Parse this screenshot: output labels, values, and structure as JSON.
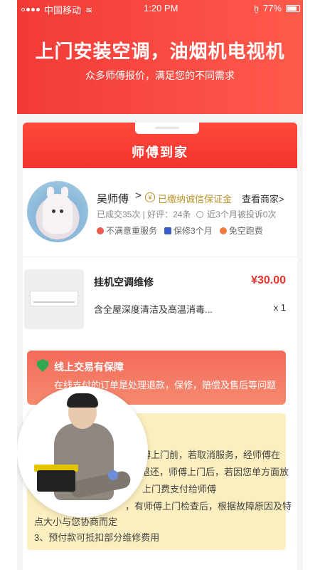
{
  "status_bar": {
    "carrier": "中国移动",
    "time": "1:20 PM",
    "battery": "77%"
  },
  "header": {
    "title": "上门安装空调，油烟机电视机",
    "subtitle": "众多师傅报价，满足您的不同需求"
  },
  "band": {
    "title": "师傅到家"
  },
  "master": {
    "name": "吴师傅",
    "arrow": ">",
    "deposit": "已缴纳诚信保证金",
    "view_shop": "查看商家>",
    "stats_a": "已成交35次 | 好评：24条",
    "stats_b": "近3个月被投诉0次",
    "tags": [
      "不满意重服务",
      "保修3个月",
      "免空跑费"
    ]
  },
  "service": {
    "title": "挂机空调维修",
    "price": "¥30.00",
    "desc": "含全屋深度清洁及高温消毒...",
    "qty": "x 1"
  },
  "guarantee": {
    "title": "线上交易有保障",
    "text": "在线支付的订单是处理退款，保修，赔偿及售后等问题"
  },
  "notice": {
    "line1": "师傅上门前，若取消服务，经师傅在",
    "line2": "退还，师傅上门后，若因您单方面放",
    "line3": "上门费支付给师傅",
    "line4": "，有师傅上门检查后，根据故障原因及特",
    "line5": "点大小与您协商而定",
    "line6": "3、预付款可抵扣部分维修费用"
  },
  "colors": {
    "brand_red": "#f23a37",
    "price_red": "#e8322e",
    "deposit_gold": "#b9942a",
    "notice_bg": "#fbefc0"
  }
}
